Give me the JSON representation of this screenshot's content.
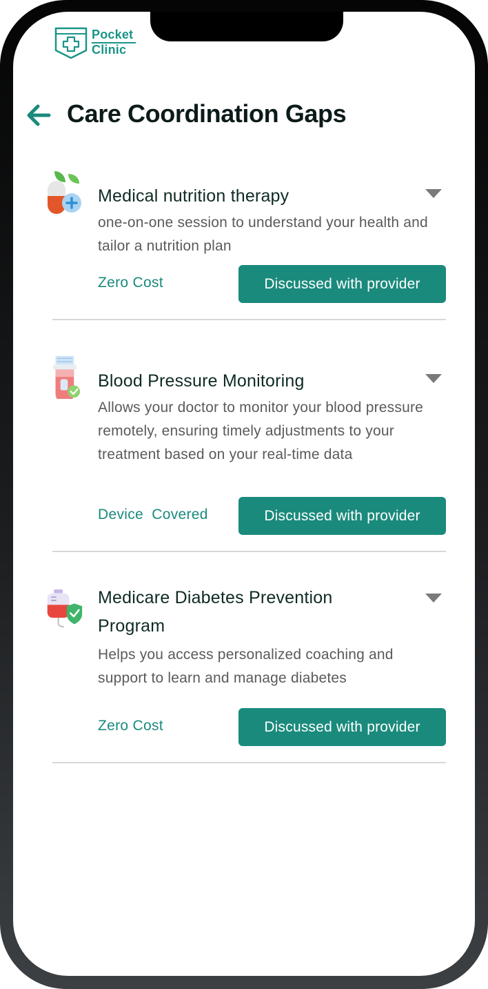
{
  "app": {
    "brand_line1": "Pocket",
    "brand_line2": "Clinic",
    "logo_icon": "medical-cross-shield-icon",
    "brand_color": "#1a9488"
  },
  "header": {
    "back_icon": "arrow-left-icon",
    "title": "Care Coordination Gaps"
  },
  "colors": {
    "accent": "#1a8a7c",
    "title_text": "#0d1a1a",
    "body_text": "#5a5a5a",
    "divider": "#d7d7d7"
  },
  "cards": [
    {
      "icon": "nutrition-pill-leaf-icon",
      "title": "Medical nutrition therapy",
      "description": "one-on-one session to understand your health and tailor a nutrition plan",
      "cost": "Zero Cost",
      "button_label": "Discussed with provider",
      "expand_icon": "caret-down-icon"
    },
    {
      "icon": "blood-test-tube-check-icon",
      "title": "Blood Pressure Monitoring",
      "description": "Allows your doctor to monitor your blood pressure remotely, ensuring timely adjustments to your treatment based on your real-time data",
      "cost": "Device  Covered",
      "button_label": "Discussed with provider",
      "expand_icon": "caret-down-icon"
    },
    {
      "icon": "iv-bag-shield-icon",
      "title": "Medicare Diabetes Prevention Program",
      "description": "Helps you access personalized coaching and support to learn and manage diabetes",
      "cost": "Zero Cost",
      "button_label": "Discussed with provider",
      "expand_icon": "caret-down-icon"
    }
  ]
}
